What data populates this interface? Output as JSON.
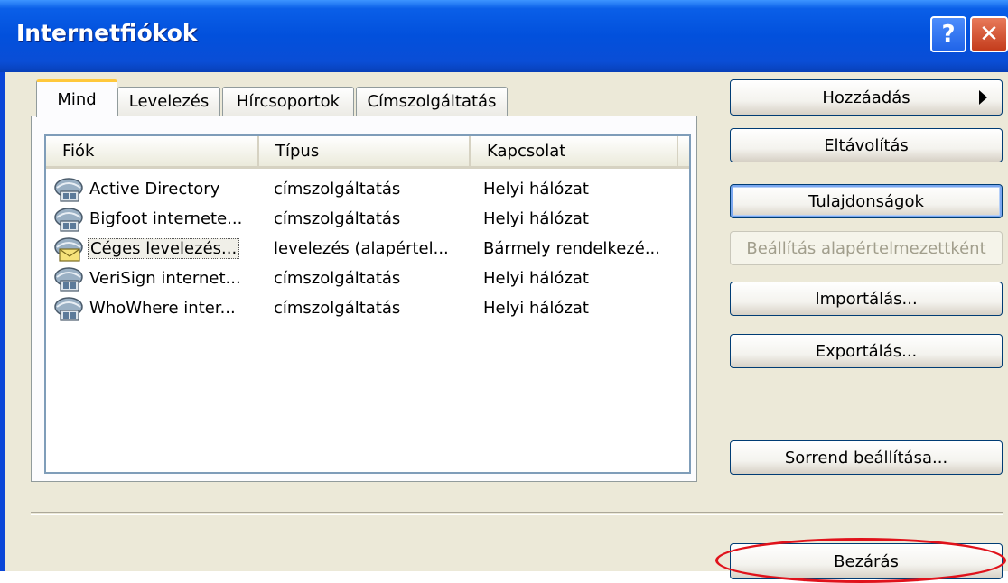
{
  "window": {
    "title": "Internetfiókok",
    "help_icon": "help-icon",
    "close_icon": "close-icon"
  },
  "tabs": [
    {
      "label": "Mind",
      "active": true
    },
    {
      "label": "Levelezés",
      "active": false
    },
    {
      "label": "Hírcsoportok",
      "active": false
    },
    {
      "label": "Címszolgáltatás",
      "active": false
    }
  ],
  "list": {
    "columns": [
      "Fiók",
      "Típus",
      "Kapcsolat"
    ],
    "rows": [
      {
        "name": "Active Directory",
        "type": "címszolgáltatás",
        "connection": "Helyi hálózat",
        "icon": "directory-service-icon"
      },
      {
        "name": "Bigfoot internete...",
        "type": "címszolgáltatás",
        "connection": "Helyi hálózat",
        "icon": "directory-service-icon"
      },
      {
        "name": "Céges levelezés...",
        "type": "levelezés (alapértel...",
        "connection": "Bármely rendelkezé...",
        "icon": "mail-account-icon"
      },
      {
        "name": "VeriSign internet...",
        "type": "címszolgáltatás",
        "connection": "Helyi hálózat",
        "icon": "directory-service-icon"
      },
      {
        "name": "WhoWhere inter...",
        "type": "címszolgáltatás",
        "connection": "Helyi hálózat",
        "icon": "directory-service-icon"
      }
    ],
    "selected_index": 2
  },
  "buttons": {
    "add": "Hozzáadás",
    "remove": "Eltávolítás",
    "properties": "Tulajdonságok",
    "set_default": "Beállítás alapértelmezettként",
    "import": "Importálás...",
    "export": "Exportálás...",
    "order": "Sorrend beállítása...",
    "close": "Bezárás"
  },
  "colors": {
    "titlebar": "#0250dc",
    "dialog_bg": "#ece9d8",
    "highlight_ellipse": "#e0121b"
  }
}
